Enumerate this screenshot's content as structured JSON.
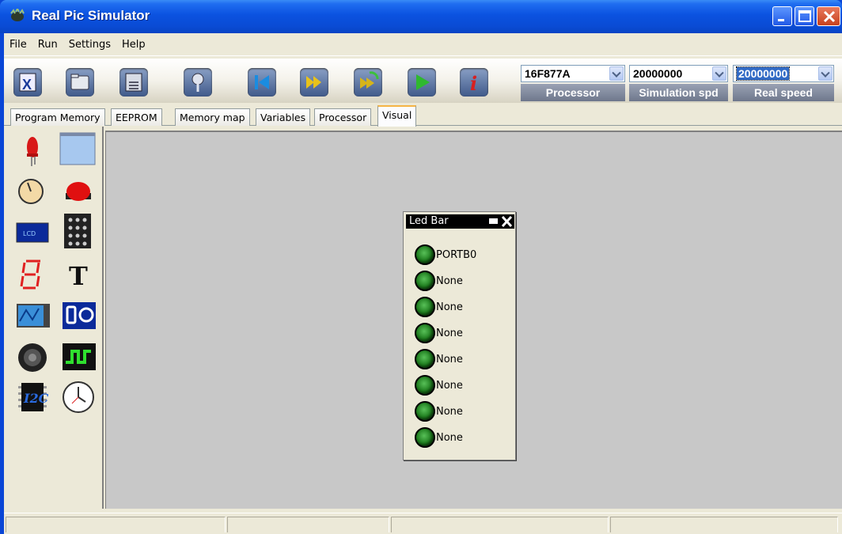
{
  "window": {
    "title": "Real Pic Simulator"
  },
  "menu": [
    "File",
    "Run",
    "Settings",
    "Help"
  ],
  "toolbar": {
    "tools": [
      {
        "icon": "close-file-icon"
      },
      {
        "icon": "open-folder-icon"
      },
      {
        "icon": "save-disk-icon"
      },
      {
        "icon": "pin-icon"
      },
      {
        "icon": "rewind-icon"
      },
      {
        "icon": "fast-forward-icon"
      },
      {
        "icon": "step-refresh-icon"
      },
      {
        "icon": "play-icon"
      },
      {
        "icon": "info-icon"
      }
    ],
    "processor": {
      "value": "16F877A",
      "label": "Processor"
    },
    "simulation_speed": {
      "value": "20000000",
      "label": "Simulation spd"
    },
    "real_speed": {
      "value": "20000000",
      "label": "Real speed"
    }
  },
  "tabs": [
    "Program Memory",
    "EEPROM",
    "Memory map",
    "Variables",
    "Processor",
    "Visual"
  ],
  "active_tab": "Visual",
  "palette": [
    "led-icon",
    "glcd-icon",
    "potentiometer-icon",
    "push-button-icon",
    "lcd-icon",
    "keypad-icon",
    "seven-segment-icon",
    "text-icon",
    "oscilloscope-icon",
    "led-bar-icon",
    "speaker-icon",
    "signal-generator-icon",
    "i2c-icon",
    "clock-icon"
  ],
  "led_bar": {
    "title": "Led Bar",
    "leds": [
      "PORTB0",
      "None",
      "None",
      "None",
      "None",
      "None",
      "None",
      "None"
    ]
  },
  "colors": {
    "title_bar": "#0a4bd4",
    "canvas": "#c8c8c8",
    "led_green": "#1c7a1c"
  }
}
